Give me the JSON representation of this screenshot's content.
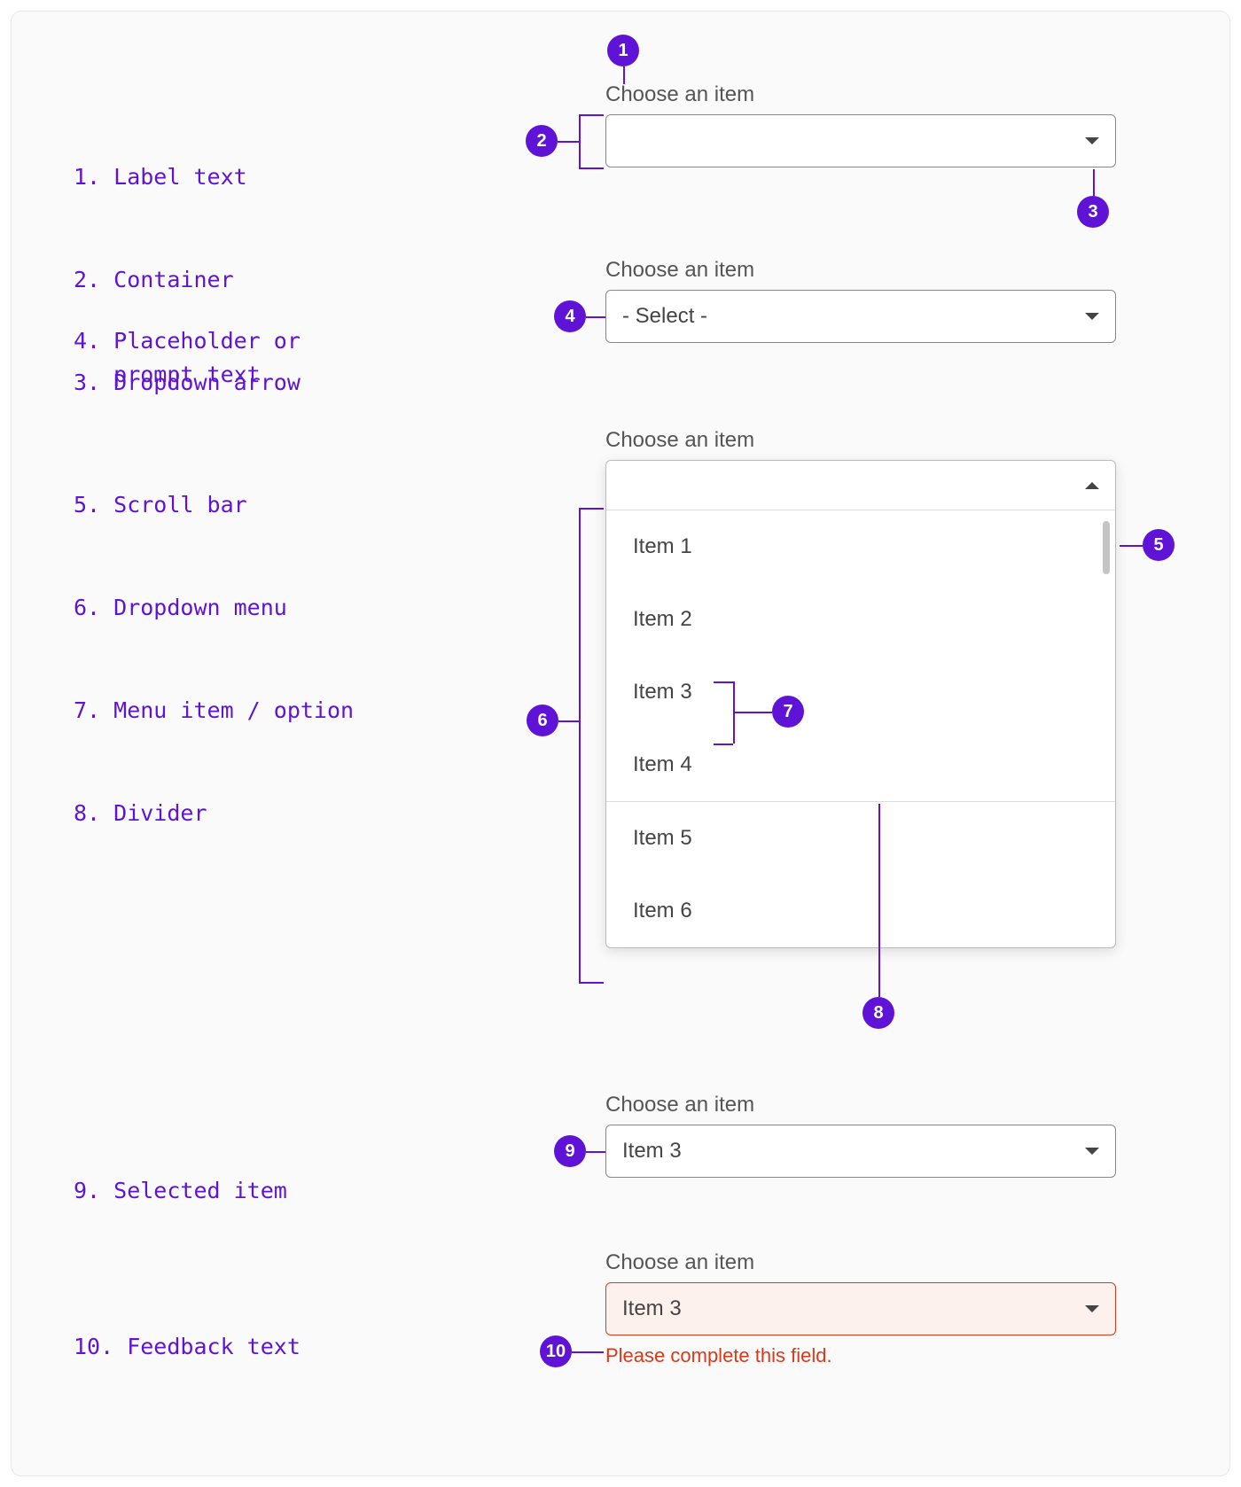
{
  "legend": {
    "items": [
      "1. Label text",
      "2. Container",
      "3. Dropdown arrow",
      "4. Placeholder or\n   prompt text",
      "5. Scroll bar",
      "6. Dropdown menu",
      "7. Menu item / option",
      "8. Divider",
      "9. Selected item",
      "10. Feedback text"
    ]
  },
  "badges": [
    "1",
    "2",
    "3",
    "4",
    "5",
    "6",
    "7",
    "8",
    "9",
    "10"
  ],
  "dropdown": {
    "label": "Choose an item",
    "placeholder": "- Select -",
    "selected": "Item 3",
    "options": [
      "Item 1",
      "Item 2",
      "Item 3",
      "Item 4",
      "Item 5",
      "Item 6"
    ],
    "error_selected": "Item 3",
    "feedback": "Please complete this field."
  }
}
